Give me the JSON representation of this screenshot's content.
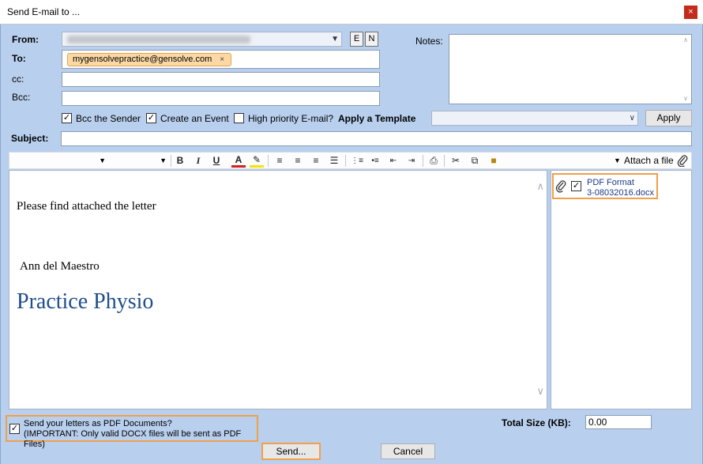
{
  "window": {
    "title": "Send E-mail to ...",
    "close_glyph": "×"
  },
  "header": {
    "from_label": "From:",
    "e_button": "E",
    "n_button": "N",
    "to_label": "To:",
    "to_chip": "mygensolvepractice@gensolve.com",
    "to_chip_remove": "×",
    "cc_label": "cc:",
    "bcc_label": "Bcc:",
    "notes_label": "Notes:"
  },
  "options": {
    "bcc_sender": "Bcc the Sender",
    "bcc_sender_checked": true,
    "create_event": "Create an Event",
    "create_event_checked": true,
    "high_priority": "High priority E-mail?",
    "high_priority_checked": false,
    "apply_template_label": "Apply a Template",
    "apply_button": "Apply"
  },
  "subject": {
    "label": "Subject:"
  },
  "toolbar": {
    "bold": "B",
    "italic": "I",
    "underline": "U",
    "font_color": "A",
    "attach_label": "Attach a file"
  },
  "editor": {
    "line1": "Please find attached the letter",
    "signature": "Ann del Maestro",
    "practice": "Practice Physio"
  },
  "attachments": [
    {
      "name_line1": "PDF Format",
      "name_line2": "3-08032016.docx",
      "checked": true
    }
  ],
  "footer": {
    "pdf_line1": "Send your letters as PDF Documents?",
    "pdf_line2": "(IMPORTANT: Only valid DOCX files will be sent as PDF Files)",
    "pdf_checked": true,
    "total_size_label": "Total Size (KB):",
    "total_size_value": "0.00",
    "send_button": "Send...",
    "cancel_button": "Cancel"
  },
  "colors": {
    "background": "#b9cfee",
    "highlight": "#f0a04b",
    "chip": "#fcd9a4",
    "practice_text": "#1f4e8c",
    "close": "#c42b1c"
  }
}
